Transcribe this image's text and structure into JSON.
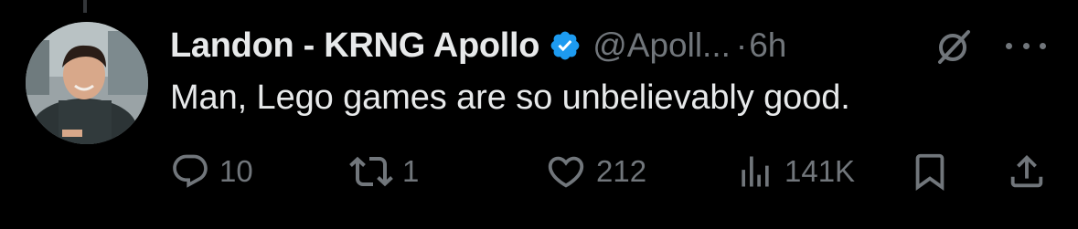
{
  "tweet": {
    "display_name": "Landon - KRNG Apollo",
    "handle": "@Apoll...",
    "separator": "·",
    "time": "6h",
    "text": "Man, Lego games are so unbelievably good.",
    "verified": true,
    "verified_color": "#1d9bf0",
    "icons": {
      "avatar": "user-avatar",
      "verified": "verified-badge-icon",
      "grok": "grok-icon",
      "more": "more-icon"
    }
  },
  "actions": {
    "reply": {
      "icon": "reply-icon",
      "count": "10"
    },
    "repost": {
      "icon": "repost-icon",
      "count": "1"
    },
    "like": {
      "icon": "like-icon",
      "count": "212"
    },
    "views": {
      "icon": "views-icon",
      "count": "141K"
    },
    "bookmark": {
      "icon": "bookmark-icon"
    },
    "share": {
      "icon": "share-icon"
    }
  },
  "colors": {
    "background": "#000000",
    "primary_text": "#e7e9ea",
    "secondary_text": "#71767b",
    "accent": "#1d9bf0"
  }
}
